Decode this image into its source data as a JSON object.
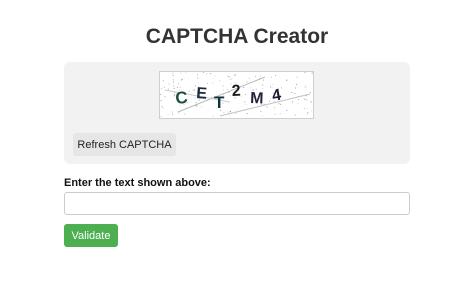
{
  "page": {
    "title": "CAPTCHA Creator"
  },
  "captcha": {
    "characters": [
      {
        "char": "C",
        "color": "#1f4f3a"
      },
      {
        "char": "E",
        "color": "#1c2a3a"
      },
      {
        "char": "T",
        "color": "#0f3540"
      },
      {
        "char": "2",
        "color": "#1a1a1a"
      },
      {
        "char": "M",
        "color": "#2a1f3d"
      },
      {
        "char": "4",
        "color": "#1a1a2e"
      }
    ],
    "refresh_label": "Refresh CAPTCHA"
  },
  "form": {
    "label": "Enter the text shown above:",
    "input_value": "",
    "input_placeholder": "",
    "validate_label": "Validate"
  },
  "colors": {
    "accent": "#4caf50",
    "panel_bg": "#f2f2f2",
    "title": "#333333"
  }
}
